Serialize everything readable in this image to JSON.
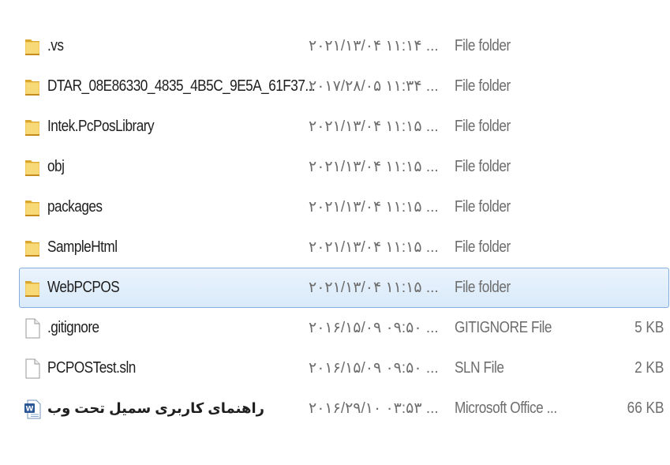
{
  "files": [
    {
      "icon": "folder-icon",
      "name": ".vs",
      "date": "۲۰۲۱/۱۳/۰۴ ۱۱:۱۴ ...",
      "type": "File folder",
      "size": "",
      "selected": false
    },
    {
      "icon": "folder-icon",
      "name": "DTAR_08E86330_4835_4B5C_9E5A_61F37...",
      "date": "۲۰۱۷/۲۸/۰۵ ۱۱:۳۴ ...",
      "type": "File folder",
      "size": "",
      "selected": false
    },
    {
      "icon": "folder-icon",
      "name": "Intek.PcPosLibrary",
      "date": "۲۰۲۱/۱۳/۰۴ ۱۱:۱۵ ...",
      "type": "File folder",
      "size": "",
      "selected": false
    },
    {
      "icon": "folder-icon",
      "name": "obj",
      "date": "۲۰۲۱/۱۳/۰۴ ۱۱:۱۵ ...",
      "type": "File folder",
      "size": "",
      "selected": false
    },
    {
      "icon": "folder-icon",
      "name": "packages",
      "date": "۲۰۲۱/۱۳/۰۴ ۱۱:۱۵ ...",
      "type": "File folder",
      "size": "",
      "selected": false
    },
    {
      "icon": "folder-icon",
      "name": "SampleHtml",
      "date": "۲۰۲۱/۱۳/۰۴ ۱۱:۱۵ ...",
      "type": "File folder",
      "size": "",
      "selected": false
    },
    {
      "icon": "folder-icon",
      "name": "WebPCPOS",
      "date": "۲۰۲۱/۱۳/۰۴ ۱۱:۱۵ ...",
      "type": "File folder",
      "size": "",
      "selected": true
    },
    {
      "icon": "file-icon",
      "name": ".gitignore",
      "date": "۲۰۱۶/۱۵/۰۹ ۰۹:۵۰ ...",
      "type": "GITIGNORE File",
      "size": "5 KB",
      "selected": false
    },
    {
      "icon": "file-icon",
      "name": "PCPOSTest.sln",
      "date": "۲۰۱۶/۱۵/۰۹ ۰۹:۵۰ ...",
      "type": "SLN File",
      "size": "2 KB",
      "selected": false
    },
    {
      "icon": "word-doc-icon",
      "name": "راهنمای کاربری سمیل تحت وب",
      "date": "۲۰۱۶/۲۹/۱۰ ۰۳:۵۳ ...",
      "type": "Microsoft Office ...",
      "size": "66 KB",
      "selected": false
    }
  ]
}
